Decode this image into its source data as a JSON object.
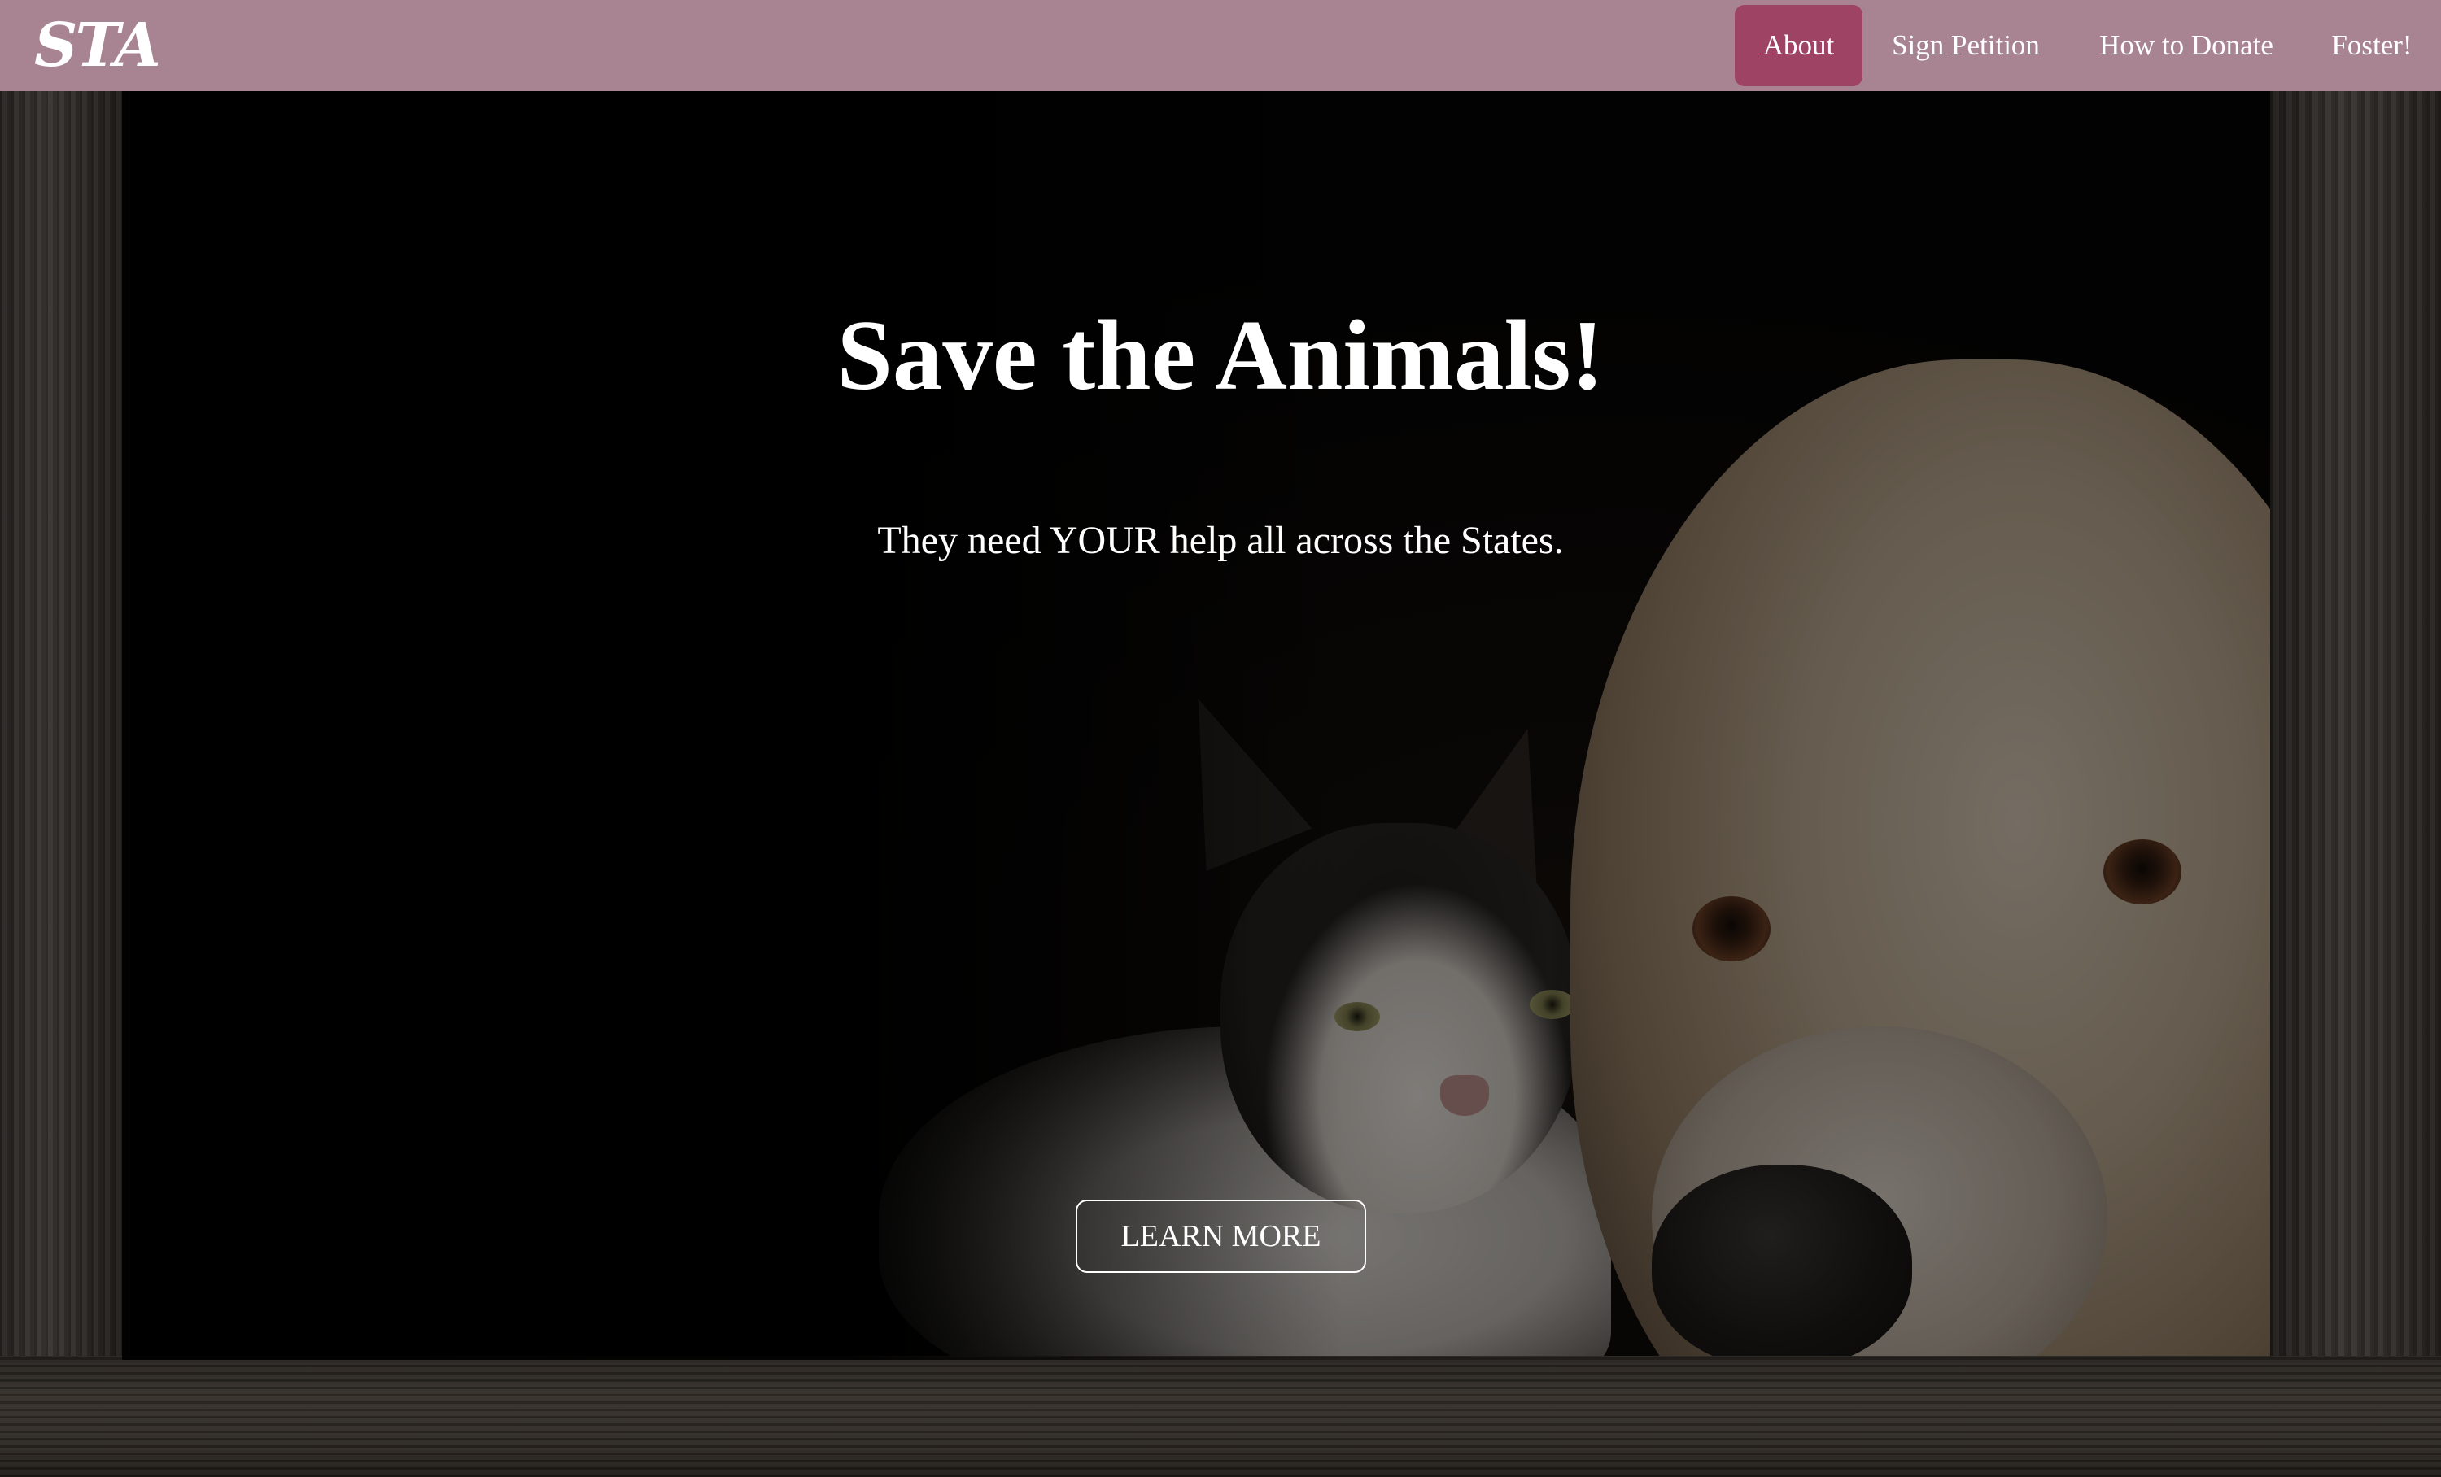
{
  "navbar": {
    "brand": "STA",
    "links": [
      {
        "label": "About",
        "active": true
      },
      {
        "label": "Sign Petition",
        "active": false
      },
      {
        "label": "How to Donate",
        "active": false
      },
      {
        "label": "Foster!",
        "active": false
      }
    ]
  },
  "hero": {
    "title": "Save the Animals!",
    "subtitle": "They need YOUR help all across the States.",
    "cta_label": "LEARN MORE",
    "image_subject": "cat and dog looking through a wooden frame"
  },
  "colors": {
    "navbar_bg": "#a88391",
    "active_link_bg": "#9e4364",
    "text": "#ffffff",
    "hero_overlay": "#000000"
  }
}
